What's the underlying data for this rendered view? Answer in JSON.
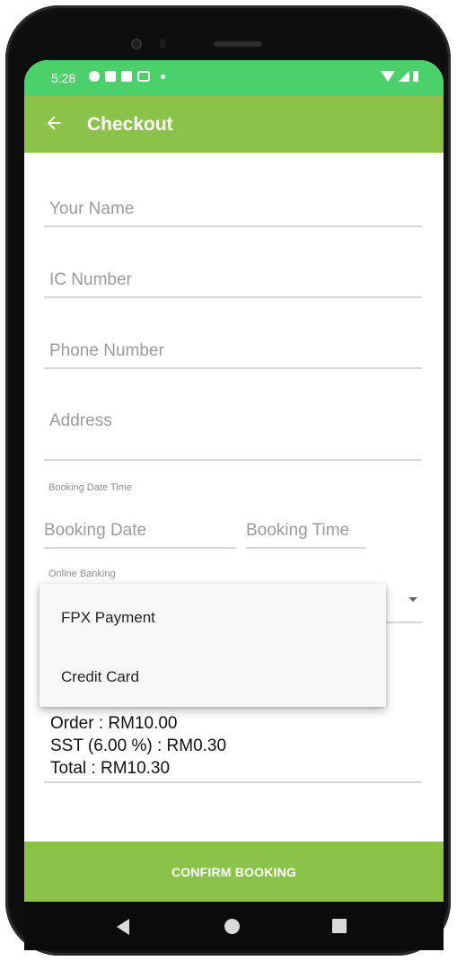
{
  "status_bar": {
    "time": "5:28",
    "left_icons": [
      "settings-icon",
      "notification-icon",
      "notification-icon",
      "voicemail-icon",
      "dot-icon"
    ],
    "right_icons": [
      "wifi-icon",
      "signal-icon",
      "battery-icon"
    ]
  },
  "app_bar": {
    "title": "Checkout",
    "back_icon": "arrow-back-icon",
    "color": "#8bc34a"
  },
  "form": {
    "name_placeholder": "Your Name",
    "ic_placeholder": "IC Number",
    "phone_placeholder": "Phone Number",
    "address_placeholder": "Address",
    "booking_label": "Booking Date Time",
    "date_placeholder": "Booking Date",
    "time_placeholder": "Booking Time",
    "payment_label": "Online Banking"
  },
  "dropdown": {
    "options": [
      "FPX Payment",
      "Credit Card"
    ]
  },
  "summary": {
    "order": "Order : RM10.00",
    "sst": "SST (6.00 %) : RM0.30",
    "total": "Total : RM10.30"
  },
  "actions": {
    "confirm_label": "CONFIRM BOOKING"
  },
  "colors": {
    "status_bar": "#4cd06b",
    "accent": "#8bc34a"
  }
}
